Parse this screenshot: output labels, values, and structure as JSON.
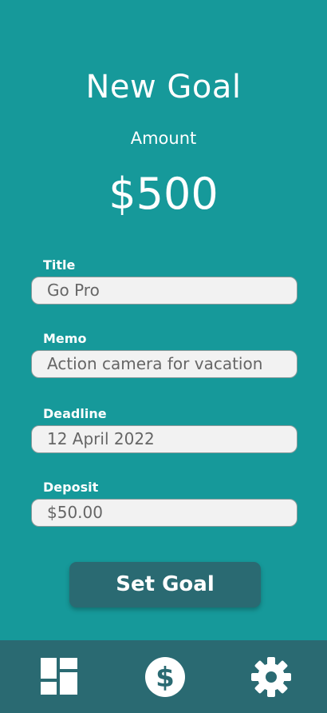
{
  "header": {
    "title": "New Goal",
    "amount_label": "Amount",
    "amount_value": "$500"
  },
  "form": {
    "fields": [
      {
        "label": "Title",
        "value": "Go Pro"
      },
      {
        "label": "Memo",
        "value": "Action camera for vacation"
      },
      {
        "label": "Deadline",
        "value": "12 April 2022"
      },
      {
        "label": "Deposit",
        "value": "$50.00"
      }
    ],
    "submit_label": "Set Goal"
  },
  "tabbar": {
    "items": [
      {
        "icon": "dashboard-icon"
      },
      {
        "icon": "dollar-icon"
      },
      {
        "icon": "gear-icon"
      }
    ]
  },
  "colors": {
    "background": "#16999a",
    "accent_dark": "#2a6a72",
    "field_background": "#f2f2f2",
    "field_text": "#666666"
  }
}
